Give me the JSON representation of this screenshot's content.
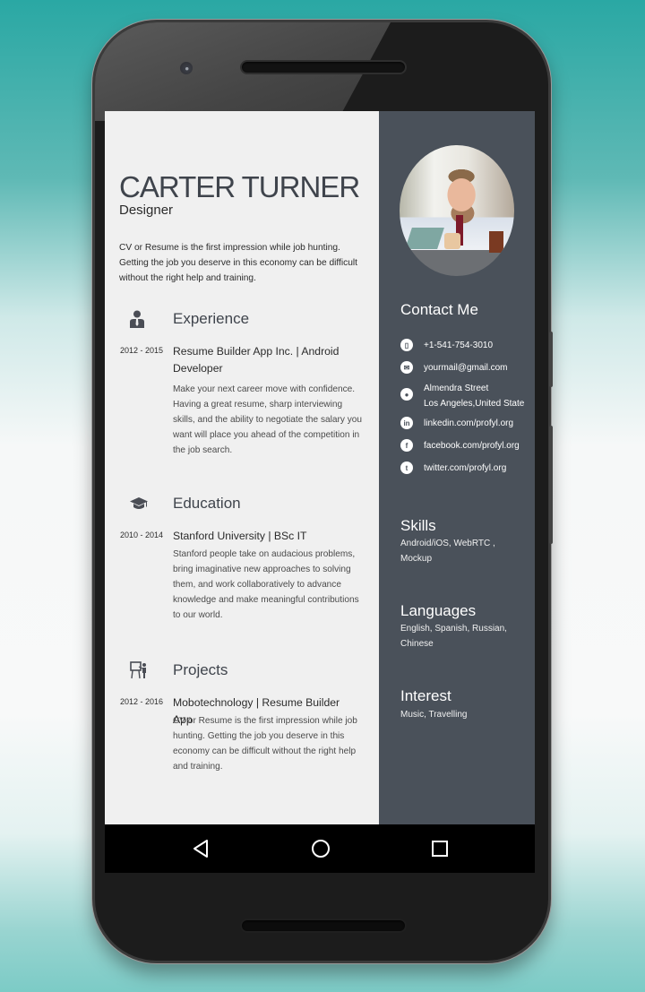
{
  "resume": {
    "name": "CARTER TURNER",
    "role": "Designer",
    "intro": "CV or Resume is the first impression while job hunting. Getting the job you deserve in this economy can be difficult without the right help and training."
  },
  "sections": [
    {
      "title": "Experience",
      "icon": "person-tie-icon",
      "date": "2012 - 2015",
      "entry_title": "Resume Builder App Inc. | Android Developer",
      "description": "Make your next career move with confidence. Having a great resume, sharp interviewing skills, and the ability to negotiate the salary you want will place you ahead of the competition in the job search."
    },
    {
      "title": "Education",
      "icon": "graduation-cap-icon",
      "date": "2010 - 2014",
      "entry_title": "Stanford University | BSc IT",
      "description": "Stanford people take on audacious problems, bring imaginative new approaches to solving them, and work collaboratively to advance knowledge and make meaningful contributions to our world."
    },
    {
      "title": "Projects",
      "icon": "presentation-board-icon",
      "date": "2012 - 2016",
      "entry_title": "Mobotechnology | Resume Builder App",
      "description": "CV or Resume is the first impression while job hunting. Getting the job you deserve in this economy can be difficult without the right help and training."
    }
  ],
  "sidebar": {
    "contact_title": "Contact Me",
    "contacts": [
      {
        "icon": "phone-icon",
        "glyph": "▯",
        "text": "+1-541-754-3010"
      },
      {
        "icon": "email-icon",
        "glyph": "✉",
        "text": "yourmail@gmail.com"
      },
      {
        "icon": "location-pin-icon",
        "glyph": "●",
        "text": "Almendra Street\nLos Angeles,United State"
      },
      {
        "icon": "linkedin-icon",
        "glyph": "in",
        "text": "linkedin.com/profyl.org"
      },
      {
        "icon": "facebook-icon",
        "glyph": "f",
        "text": "facebook.com/profyl.org"
      },
      {
        "icon": "twitter-icon",
        "glyph": "t",
        "text": "twitter.com/profyl.org"
      }
    ],
    "skills_title": "Skills",
    "skills": "Android/iOS, WebRTC , Mockup",
    "languages_title": "Languages",
    "languages": "English, Spanish, Russian, Chinese",
    "interest_title": "Interest",
    "interest": "Music, Travelling"
  },
  "navbar": {
    "back": "back-icon",
    "home": "home-icon",
    "recents": "recents-icon"
  },
  "colors": {
    "sidebar_bg": "#4a515a",
    "main_bg": "#f0f0f0",
    "heading": "#3f444c",
    "background_accent": "#2aa8a4"
  }
}
